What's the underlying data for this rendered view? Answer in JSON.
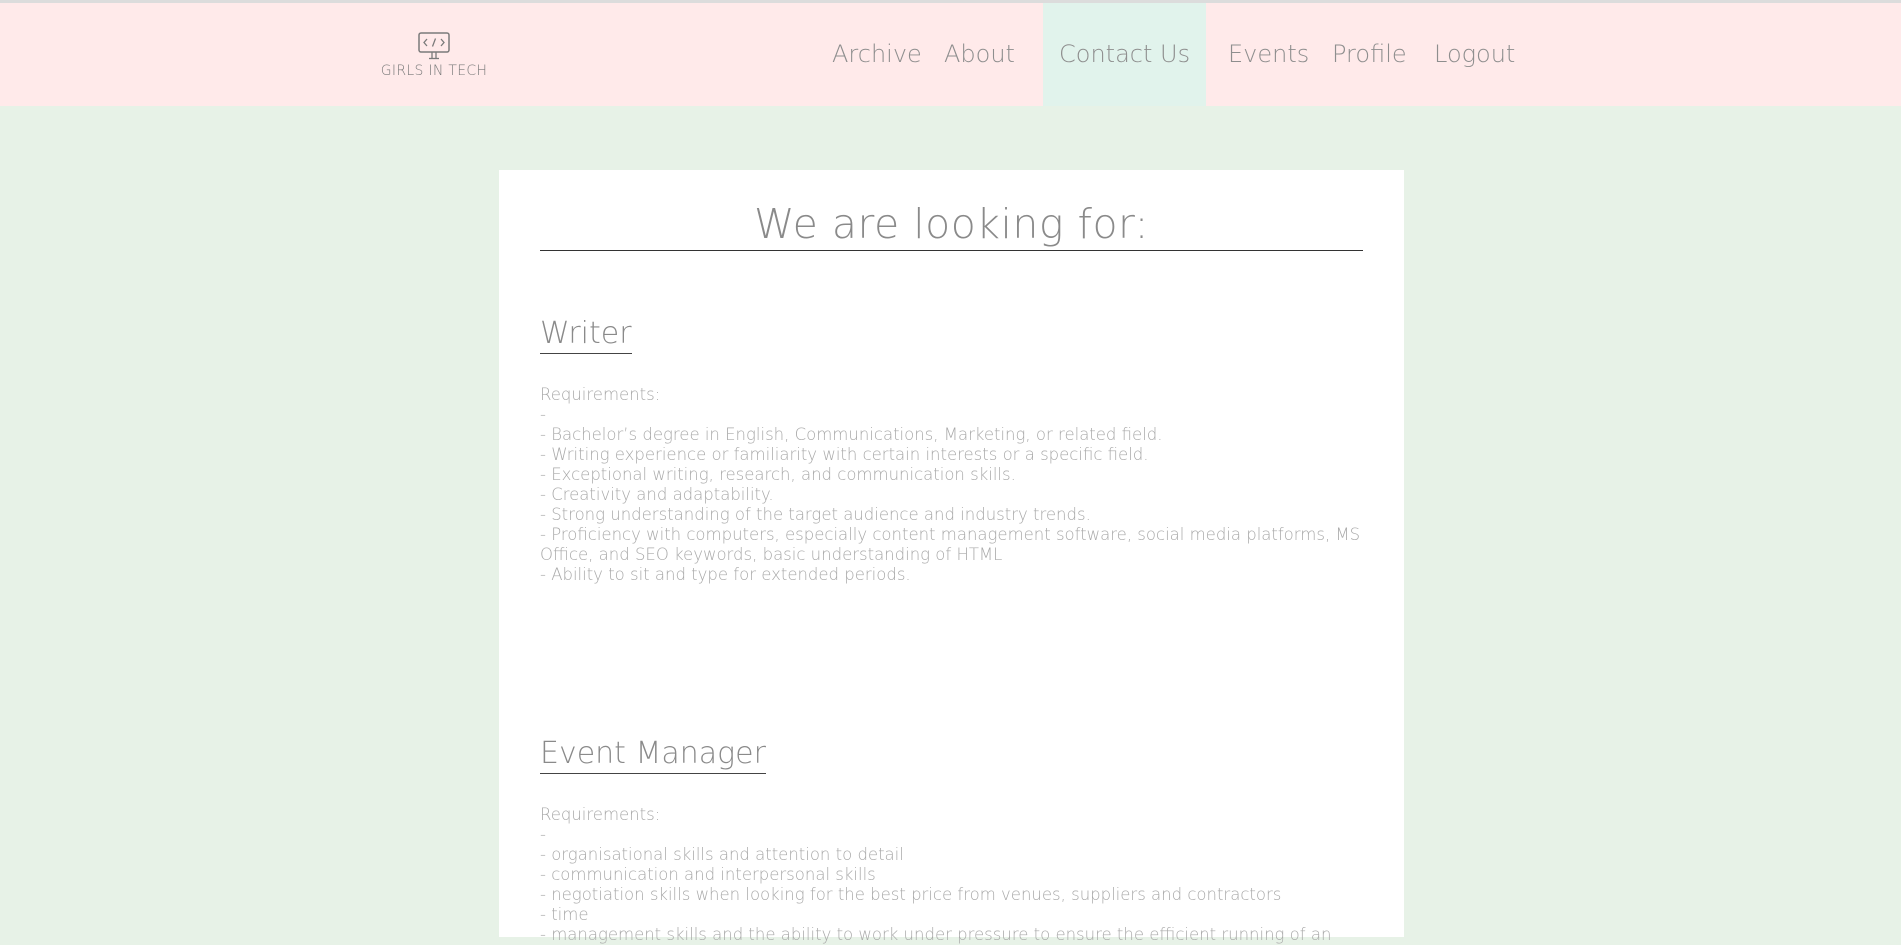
{
  "nav": {
    "logo_text": "GIRLS IN TECH",
    "items": [
      {
        "label": "Archive"
      },
      {
        "label": "About"
      },
      {
        "label": "Contact Us"
      },
      {
        "label": "Events"
      },
      {
        "label": "Profile"
      },
      {
        "label": "Logout"
      }
    ]
  },
  "colors": {
    "page_bg": "#e7f2e7",
    "nav_bg": "#ffeaea",
    "nav_active_bg": "#e1f3ec",
    "card_bg": "#ffffff"
  },
  "main": {
    "title": "We are looking for:",
    "jobs": [
      {
        "title": "Writer",
        "requirements_label": "Requirements:",
        "lines": [
          "-",
          "- Bachelor’s degree in English, Communications, Marketing, or related field.",
          "- Writing experience or familiarity with certain interests or a specific field.",
          "- Exceptional writing, research, and communication skills.",
          "- Creativity and adaptability.",
          "- Strong understanding of the target audience and industry trends.",
          "- Proficiency with computers, especially content management software, social media platforms, MS Office, and SEO keywords, basic understanding of HTML",
          "- Ability to sit and type for extended periods."
        ]
      },
      {
        "title": "Event Manager",
        "requirements_label": "Requirements:",
        "lines": [
          "-",
          "- organisational skills and attention to detail",
          "- communication and interpersonal skills",
          "- negotiation skills when looking for the best price from venues, suppliers and contractors",
          "- time",
          "- management skills and the ability to work under pressure to ensure the efficient running of an"
        ]
      }
    ]
  }
}
